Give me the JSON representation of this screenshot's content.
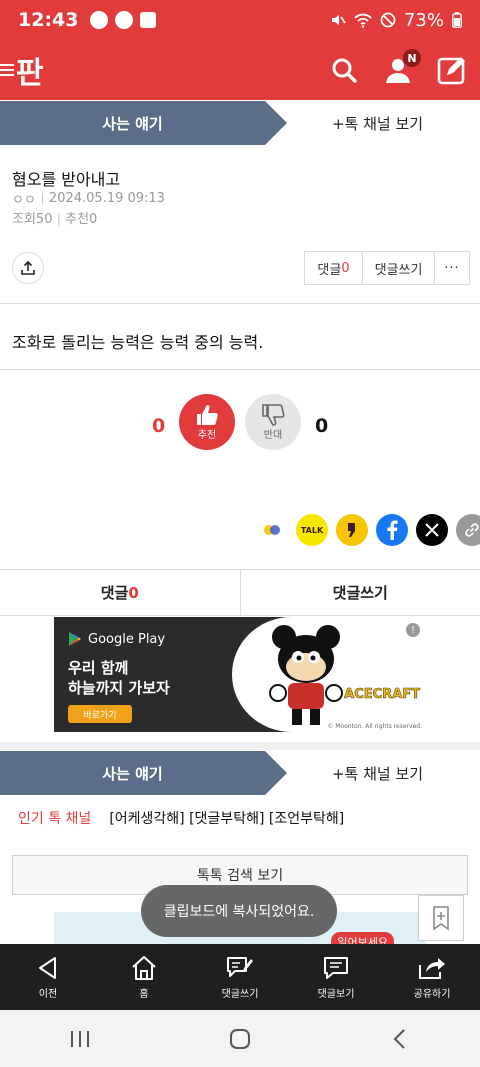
{
  "status_bar": {
    "time": "12:43",
    "battery": "73%"
  },
  "app": {
    "logo": "판"
  },
  "channel_bar": {
    "current": "사는 얘기",
    "link": "+톡 채널 보기"
  },
  "post": {
    "title": "혐오를 받아내고",
    "author": "ㅇㅇ",
    "datetime": "2024.05.19 09:13",
    "views": "조회50",
    "recommends": "추천0",
    "body": "조화로 돌리는 능력은 능력 중의 능력."
  },
  "comment_buttons": {
    "label": "댓글",
    "count": "0",
    "write": "댓글쓰기",
    "more": "···"
  },
  "vote": {
    "up_count": "0",
    "up_label": "추천",
    "down_label": "반대",
    "down_count": "0"
  },
  "social": {
    "kakaotalk": "TALK"
  },
  "comment_tabs": {
    "label": "댓글",
    "count": "0",
    "write": "댓글쓰기"
  },
  "ad": {
    "store": "Google Play",
    "line1": "우리 함께",
    "line2": "하늘까지 가보자",
    "cta": "바로가기",
    "brand": "ACECRAFT",
    "copyright": "© Moonton. All rights reserved."
  },
  "channel_bar2": {
    "current": "사는 얘기",
    "link": "+톡 채널 보기"
  },
  "popular": {
    "label": "인기 톡 채널",
    "channels": "[어케생각해] [댓글부탁해] [조언부탁해]"
  },
  "search_button": "톡톡 검색 보기",
  "peek": {
    "tag": "일어보세요"
  },
  "toast": "클립보드에 복사되었어요.",
  "toolbar": [
    {
      "label": "이전"
    },
    {
      "label": "홈"
    },
    {
      "label": "댓글쓰기"
    },
    {
      "label": "댓글보기"
    },
    {
      "label": "공유하기"
    }
  ],
  "colors": {
    "brand": "#e23b3b",
    "channel": "#5a6d86",
    "toolbar": "#1f1f1f"
  }
}
